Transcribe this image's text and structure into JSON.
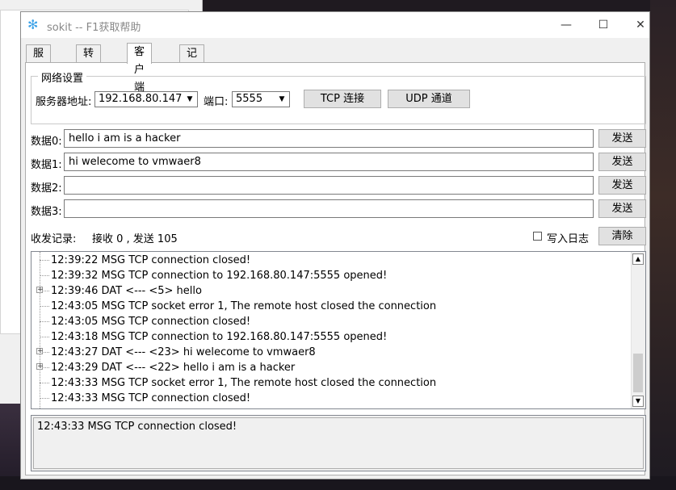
{
  "window": {
    "title": "sokit -- F1获取帮助",
    "minimize": "—",
    "maximize": "☐",
    "close": "✕"
  },
  "tabs": [
    {
      "label": "服务器"
    },
    {
      "label": "转发器"
    },
    {
      "label": "客户端"
    },
    {
      "label": "记事板"
    }
  ],
  "network": {
    "group_title": "网络设置",
    "server_addr_label": "服务器地址:",
    "server_addr_value": "192.168.80.147",
    "port_label": "端口:",
    "port_value": "5555",
    "tcp_button": "TCP 连接",
    "udp_button": "UDP 通道"
  },
  "data_rows": [
    {
      "label": "数据0:",
      "value": "hello i am is a hacker",
      "send": "发送"
    },
    {
      "label": "数据1:",
      "value": "hi welecome  to vmwaer8",
      "send": "发送"
    },
    {
      "label": "数据2:",
      "value": "",
      "send": "发送"
    },
    {
      "label": "数据3:",
      "value": "",
      "send": "发送"
    }
  ],
  "records": {
    "label": "收发记录:",
    "counts": "接收 0 , 发送 105",
    "write_log_label": "写入日志",
    "write_log_checked": false,
    "clear_button": "清除"
  },
  "log": [
    {
      "text": "12:39:22 MSG TCP connection closed!",
      "expandable": false
    },
    {
      "text": "12:39:32 MSG TCP connection to 192.168.80.147:5555 opened!",
      "expandable": false
    },
    {
      "text": "12:39:46 DAT <--- <5> hello",
      "expandable": true
    },
    {
      "text": "12:43:05 MSG TCP socket error 1, The remote host closed the connection",
      "expandable": false
    },
    {
      "text": "12:43:05 MSG TCP connection closed!",
      "expandable": false
    },
    {
      "text": "12:43:18 MSG TCP connection to 192.168.80.147:5555 opened!",
      "expandable": false
    },
    {
      "text": "12:43:27 DAT <--- <23> hi welecome  to vmwaer8",
      "expandable": true
    },
    {
      "text": "12:43:29 DAT <--- <22> hello i am is a hacker",
      "expandable": true
    },
    {
      "text": "12:43:33 MSG TCP socket error 1, The remote host closed the connection",
      "expandable": false
    },
    {
      "text": "12:43:33 MSG TCP connection closed!",
      "expandable": false
    }
  ],
  "status": {
    "text": "12:43:33 MSG TCP connection closed!"
  },
  "icons": {
    "app": "snowflake-icon",
    "expand": "plus-box-icon",
    "dropdown": "chevron-down-icon"
  },
  "colors": {
    "app_icon": "#3fa3e8",
    "title_text": "#888888"
  }
}
